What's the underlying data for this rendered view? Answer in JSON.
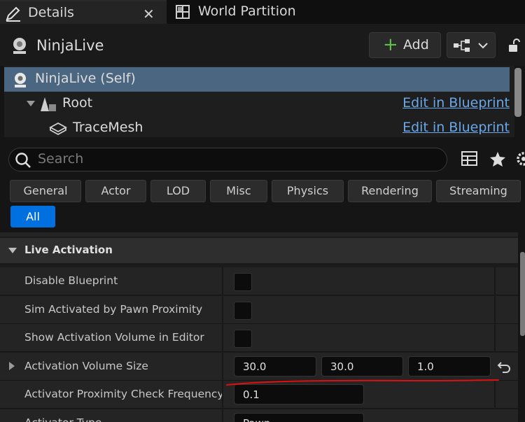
{
  "tabs": {
    "details_label": "Details",
    "world_partition_label": "World Partition"
  },
  "actor": {
    "name": "NinjaLive",
    "add_label": "Add"
  },
  "tree": {
    "items": [
      {
        "label": "NinjaLive (Self)",
        "link": ""
      },
      {
        "label": "Root",
        "link": "Edit in Blueprint"
      },
      {
        "label": "TraceMesh",
        "link": "Edit in Blueprint"
      }
    ]
  },
  "search": {
    "placeholder": "Search"
  },
  "categories": [
    "General",
    "Actor",
    "LOD",
    "Misc",
    "Physics",
    "Rendering",
    "Streaming",
    "All"
  ],
  "section": {
    "title": "Live Activation",
    "rows": [
      {
        "label": "Disable Blueprint",
        "checked": false
      },
      {
        "label": "Sim Activated by Pawn Proximity",
        "checked": false
      },
      {
        "label": "Show Activation Volume in Editor",
        "checked": false
      },
      {
        "label": "Activation Volume Size",
        "x": "30.0",
        "y": "30.0",
        "z": "1.0"
      },
      {
        "label": "Activator Proximity Check Frequency",
        "value": "0.1"
      },
      {
        "label": "Activator Type",
        "value": "Pawn"
      }
    ]
  },
  "colors": {
    "accent": "#0070e0",
    "selection": "#4a6680",
    "link": "#68a8ea",
    "annotation": "#e01010"
  }
}
